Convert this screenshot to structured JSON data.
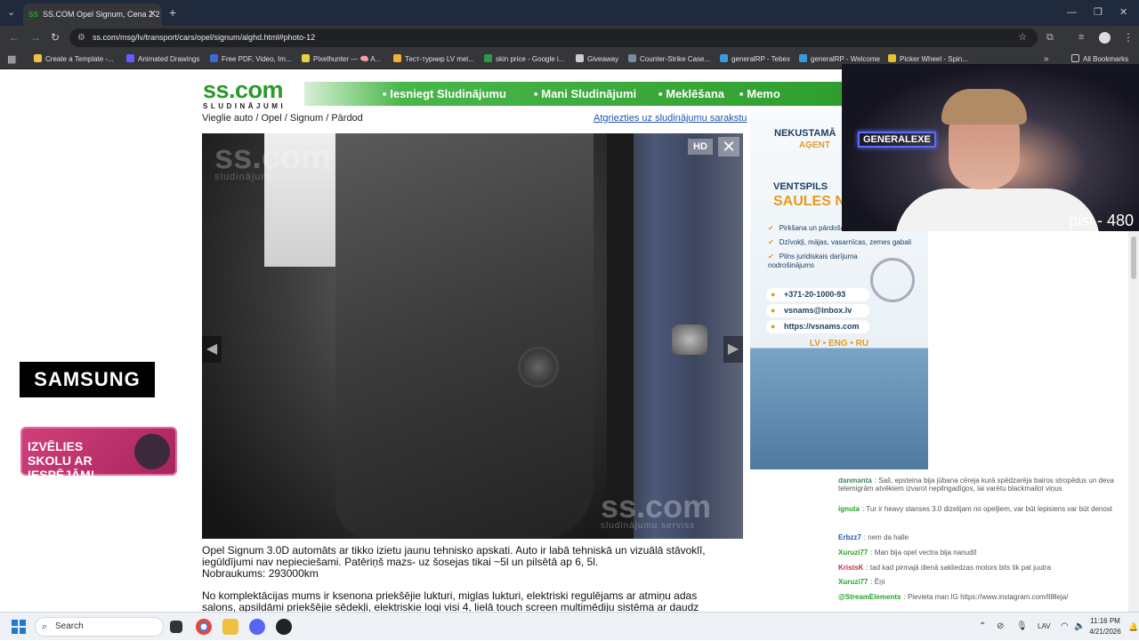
{
  "browser": {
    "tab_title": "SS.COM Opel Signum, Cena 2 2",
    "tab_favicon": "SS",
    "url": "ss.com/msg/lv/transport/cars/opel/signum/alghd.html#photo-12",
    "bookmarks": [
      {
        "label": "Create a Template -...",
        "color": "#f0c040"
      },
      {
        "label": "Animated Drawings",
        "color": "#6a5cff"
      },
      {
        "label": "Free PDF, Video, Im...",
        "color": "#3a6ad6"
      },
      {
        "label": "Pixelhunter — 🧠 A...",
        "color": "#e8d040"
      },
      {
        "label": "Тест-турнир LV mei...",
        "color": "#f0b030"
      },
      {
        "label": "skin price - Google i...",
        "color": "#2a9a4a"
      },
      {
        "label": "Giveaway",
        "color": "#cccccc"
      },
      {
        "label": "Counter-Strike Case...",
        "color": "#7a8aa0"
      },
      {
        "label": "generalRP - Tebex",
        "color": "#3a9adf"
      },
      {
        "label": "generalRP - Welcome",
        "color": "#3a9adf"
      },
      {
        "label": "Picker Wheel - Spin...",
        "color": "#e8c030"
      }
    ],
    "all_bookmarks": "All Bookmarks"
  },
  "site": {
    "logo": "ss.com",
    "logo_sub": "SLUDINĀJUMI",
    "nav": [
      "Iesniegt Sludinājumu",
      "Mani Sludinājumi",
      "Meklēšana",
      "Memo"
    ],
    "breadcrumb": "Vieglie auto / Opel / Signum / Pārdod",
    "back_link": "Atgriezties uz sludinājumu sarakstu",
    "photo": {
      "watermark": "ss.com",
      "watermark_sub": "sludinājumu serviss",
      "hd": "HD",
      "close": "✕",
      "prev": "◀",
      "next": "▶"
    },
    "description": {
      "p1": "Opel Signum 3.0D automāts ar tikko izietu jaunu tehnisko apskati. Auto ir labā tehniskā un vizuālā stāvoklī, iegūldījumi nav nepieciešami. Patēriņš mazs- uz šosejas tikai ~5l un pilsētā ap 6, 5l.",
      "mileage": "Nobraukums: 293000km",
      "p2": "No komplektācijas mums ir ksenona priekšējie lukturi, miglas lukturi, elektriski regulējams ar atmiņu adas salons, apsildāmi priekšējie sēdekļi, elektriskie logi visi 4, lielā touch screen multimēdiju sistēma ar daudz"
    }
  },
  "ads": {
    "samsung": "SAMSUNG",
    "skola": "IZVĒLIES SKOLU AR IESPĒJĀM!",
    "realty": {
      "line1": "NEKUSTAMĀ",
      "line2": "AĢENT",
      "city": "VENTSPILS",
      "brand": "SAULES N",
      "features": [
        "Pirkšana un pārdošana",
        "Dzīvokļi, mājas, vasarnīcas, zemes gabali",
        "Pilns juridiskais darījuma nodrošinājums"
      ],
      "phone": "+371-20-1000-93",
      "email": "vsnams@inbox.lv",
      "web": "https://vsnams.com",
      "langs": "LV • ENG • RU"
    }
  },
  "stream": {
    "neon_sign": "GENERALEXE",
    "overlay_text": "pisi - 480",
    "chat": [
      {
        "user": "danmanta",
        "color": "#3a8a5a",
        "text": ": Saš, epsteina bija jūbana cēreja kurā spēdzarēja bairos stropēdus un deva telemigrām atvēkiem izvarot nepilngadīgos, lai varētu blackmailot viņus"
      },
      {
        "user": "ignuta",
        "color": "#2aa02a",
        "text": ": Tur ir heavy stanses 3.0 dizelijam no opeljiem, var būt lepisiens var būt denost"
      },
      {
        "user": "Erbzz7",
        "color": "#2255aa",
        "text": ": nem da halle"
      },
      {
        "user": "Xuruzi77",
        "color": "#2aa02a",
        "text": ": Man bija opel vectra bija nanudīl"
      },
      {
        "user": "KristsK",
        "color": "#c0304a",
        "text": ": tad kad pirmajā dienā sakliedzas motors bits tik pat juutra"
      },
      {
        "user": "Xuruzi77",
        "color": "#2aa02a",
        "text": ": Ēņi"
      },
      {
        "user": "@StreamElements",
        "color": "#2aa02a",
        "text": ": Pievieta man IG https://www.instagram.com/lllllleja/"
      }
    ]
  },
  "taskbar": {
    "search": "Search",
    "lang": "LAV",
    "time": "11:16 PM",
    "date": "4/21/2026"
  }
}
